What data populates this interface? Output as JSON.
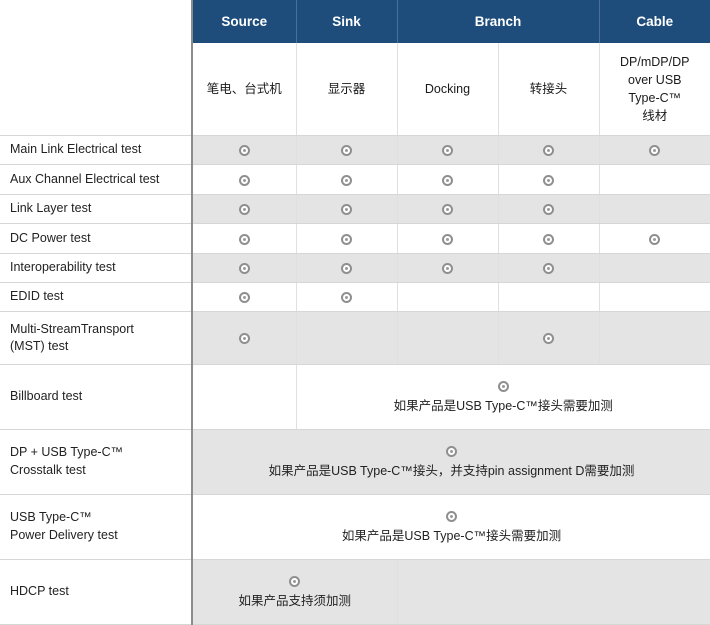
{
  "table": {
    "corner_blank": "",
    "group_headers": [
      {
        "label": "Source",
        "span": 1
      },
      {
        "label": "Sink",
        "span": 1
      },
      {
        "label": "Branch",
        "span": 2
      },
      {
        "label": "Cable",
        "span": 1
      }
    ],
    "sub_headers": [
      "笔电、台式机",
      "显示器",
      "Docking",
      "转接头",
      "DP/mDP/DP over USB Type-C™ 线材"
    ],
    "sub_headers_lines": {
      "source": "笔电、台式机",
      "sink": "显示器",
      "docking": "Docking",
      "adapter": "转接头",
      "cable_l1": "DP/mDP/DP",
      "cable_l2": "over USB",
      "cable_l3": "Type-C™",
      "cable_l4": "线材"
    },
    "marker_symbol": "double-circle",
    "rows": [
      {
        "label": "Main Link Electrical test",
        "shade": true,
        "cells": [
          {
            "type": "mark"
          },
          {
            "type": "mark"
          },
          {
            "type": "mark"
          },
          {
            "type": "mark"
          },
          {
            "type": "mark"
          }
        ]
      },
      {
        "label": "Aux Channel Electrical test",
        "shade": false,
        "cells": [
          {
            "type": "mark"
          },
          {
            "type": "mark"
          },
          {
            "type": "mark"
          },
          {
            "type": "mark"
          },
          {
            "type": "empty"
          }
        ]
      },
      {
        "label": "Link Layer test",
        "shade": true,
        "cells": [
          {
            "type": "mark"
          },
          {
            "type": "mark"
          },
          {
            "type": "mark"
          },
          {
            "type": "mark"
          },
          {
            "type": "empty"
          }
        ]
      },
      {
        "label": "DC Power test",
        "shade": false,
        "cells": [
          {
            "type": "mark"
          },
          {
            "type": "mark"
          },
          {
            "type": "mark"
          },
          {
            "type": "mark"
          },
          {
            "type": "mark"
          }
        ]
      },
      {
        "label": "Interoperability test",
        "shade": true,
        "cells": [
          {
            "type": "mark"
          },
          {
            "type": "mark"
          },
          {
            "type": "mark"
          },
          {
            "type": "mark"
          },
          {
            "type": "empty"
          }
        ]
      },
      {
        "label": "EDID test",
        "shade": false,
        "cells": [
          {
            "type": "mark"
          },
          {
            "type": "mark"
          },
          {
            "type": "empty"
          },
          {
            "type": "empty"
          },
          {
            "type": "empty"
          }
        ]
      },
      {
        "label": "Multi-StreamTransport (MST) test",
        "label_l1": "Multi-StreamTransport",
        "label_l2": "(MST) test",
        "shade": true,
        "cells": [
          {
            "type": "mark"
          },
          {
            "type": "empty"
          },
          {
            "type": "empty"
          },
          {
            "type": "mark"
          },
          {
            "type": "empty"
          }
        ]
      },
      {
        "label": "Billboard test",
        "shade": false,
        "cells": [
          {
            "type": "empty"
          },
          {
            "type": "note",
            "span": 4,
            "text": "如果产品是USB Type-C™接头需要加测"
          }
        ]
      },
      {
        "label": "DP + USB Type-C™ Crosstalk test",
        "label_l1": "DP + USB Type-C™",
        "label_l2": "Crosstalk test",
        "shade": true,
        "cells": [
          {
            "type": "note",
            "span": 5,
            "text": "如果产品是USB Type-C™接头，并支持pin assignment D需要加测"
          }
        ]
      },
      {
        "label": "USB Type-C™ Power Delivery test",
        "label_l1": "USB Type-C™",
        "label_l2": "Power Delivery test",
        "shade": false,
        "cells": [
          {
            "type": "note",
            "span": 5,
            "text": "如果产品是USB Type-C™接头需要加测"
          }
        ]
      },
      {
        "label": "HDCP test",
        "shade": true,
        "cells": [
          {
            "type": "note",
            "span": 2,
            "text": "如果产品支持须加测"
          },
          {
            "type": "empty",
            "span": 3
          }
        ]
      }
    ]
  },
  "colors": {
    "header_blue": "#1E4D7B",
    "header_text": "#FFFFFF",
    "shade_row": "#E4E4E4",
    "plain_row": "#FFFFFF",
    "grid_line": "#D6D6D6",
    "label_divider": "#8C8C8C",
    "marker_gray": "#8F8F8F",
    "body_text": "#222222"
  }
}
